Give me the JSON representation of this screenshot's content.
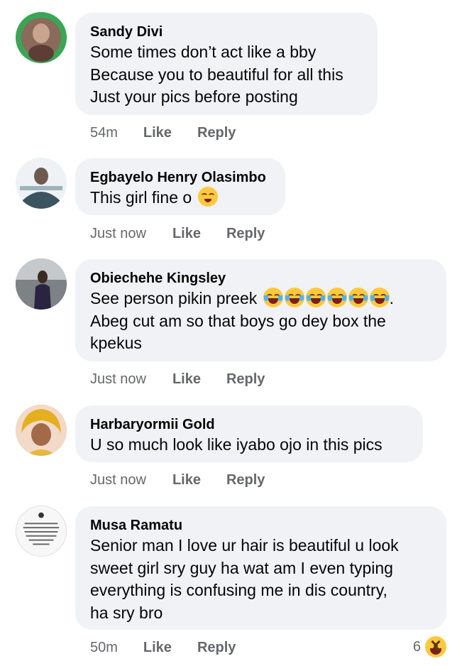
{
  "comments": [
    {
      "author": "Sandy Divi",
      "lines": [
        "Some times don’t act like a bby",
        "Because you to beautiful for all this",
        "Just your pics before posting"
      ],
      "time": "54m",
      "like": "Like",
      "reply": "Reply"
    },
    {
      "author": "Egbayelo Henry Olasimbo",
      "lines": [
        "This girl fine o"
      ],
      "emoji": "smiling-face-with-hearts",
      "time": "Just now",
      "like": "Like",
      "reply": "Reply"
    },
    {
      "author": "Obiechehe Kingsley",
      "lines": [
        "See person pikin preek",
        "Abeg cut am so that boys go dey box the",
        "kpekus"
      ],
      "emoji": "rolling-laughing x6",
      "trailing": ".",
      "time": "Just now",
      "like": "Like",
      "reply": "Reply"
    },
    {
      "author": "Harbaryormii Gold",
      "lines": [
        "U so much look like iyabo ojo in this pics"
      ],
      "time": "Just now",
      "like": "Like",
      "reply": "Reply"
    },
    {
      "author": "Musa Ramatu",
      "lines": [
        "Senior man I love ur hair is beautiful u look",
        "sweet girl sry guy ha wat am I even typing",
        "everything is confusing me in dis country,",
        "ha sry bro"
      ],
      "time": "50m",
      "like": "Like",
      "reply": "Reply",
      "reaction_count": "6",
      "reaction_emoji": "laughing-face"
    }
  ],
  "colors": {
    "bubble": "#f0f2f5",
    "meta": "#65676b",
    "text": "#050505"
  }
}
